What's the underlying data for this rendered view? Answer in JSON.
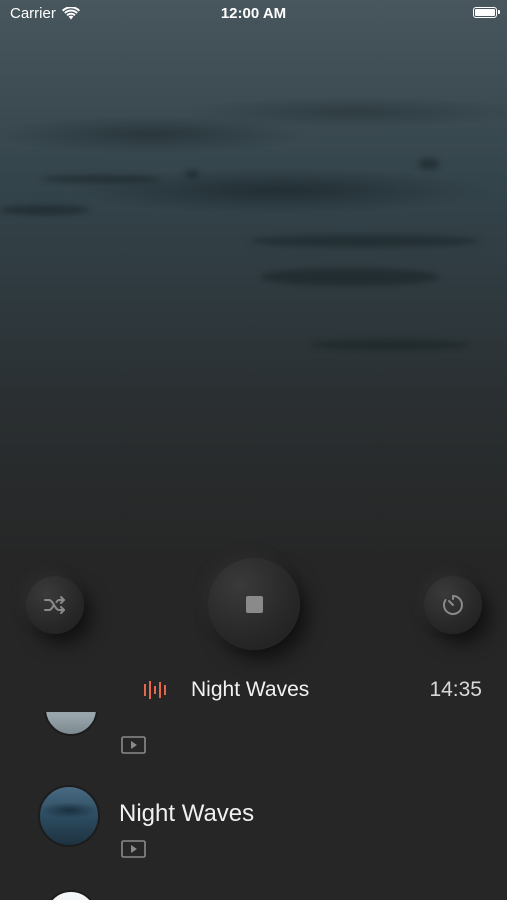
{
  "status_bar": {
    "carrier": "Carrier",
    "time": "12:00 AM",
    "icons": [
      "wifi-icon",
      "battery-icon"
    ]
  },
  "controls": {
    "shuffle_icon": "shuffle-icon",
    "stop_icon": "stop-icon",
    "timer_icon": "timer-icon"
  },
  "now_playing": {
    "icon": "audio-bars-icon",
    "title": "Night Waves",
    "time_remaining": "14:35",
    "accent_color": "#e26a4a"
  },
  "list": {
    "items": [
      {
        "title": "",
        "media_icon": "video-play-icon"
      },
      {
        "title": "Night Waves",
        "media_icon": "video-play-icon"
      },
      {
        "title": "",
        "media_icon": ""
      }
    ]
  },
  "colors": {
    "background": "#262626",
    "control_icon": "#8a8a8a"
  }
}
